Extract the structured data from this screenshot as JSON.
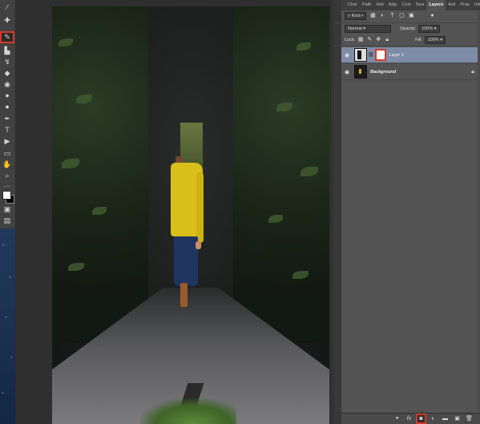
{
  "toolbar": {
    "tools": [
      {
        "id": "eyedropper",
        "glyph": "⁄"
      },
      {
        "id": "healing",
        "glyph": "✚"
      },
      {
        "id": "brush",
        "glyph": "✎"
      },
      {
        "id": "stamp",
        "glyph": "▙"
      },
      {
        "id": "history",
        "glyph": "↯"
      },
      {
        "id": "eraser",
        "glyph": "◆"
      },
      {
        "id": "gradient",
        "glyph": "◉"
      },
      {
        "id": "blur",
        "glyph": "●"
      },
      {
        "id": "dodge",
        "glyph": "●"
      },
      {
        "id": "pen",
        "glyph": "✒"
      },
      {
        "id": "text",
        "glyph": "T"
      },
      {
        "id": "path-select",
        "glyph": "▶"
      },
      {
        "id": "shape",
        "glyph": "▭"
      },
      {
        "id": "hand",
        "glyph": "✋"
      },
      {
        "id": "zoom",
        "glyph": "⌕"
      },
      {
        "id": "more",
        "glyph": "…"
      }
    ],
    "active_tool": "brush"
  },
  "panel": {
    "tabs": [
      "Char",
      "Path",
      "Hist",
      "Adjs",
      "Colo",
      "Swa",
      "Layers",
      "Acti",
      "Prop",
      "Info"
    ],
    "active_tab": "Layers",
    "filter": {
      "kind_label": "Kind"
    },
    "blend_mode": "Normal",
    "opacity_label": "Opacity:",
    "opacity_value": "100%",
    "lock_label": "Lock:",
    "fill_label": "Fill:",
    "fill_value": "100%",
    "layers": [
      {
        "name": "Layer 1",
        "selected": true,
        "has_mask": true
      },
      {
        "name": "Background",
        "selected": false,
        "locked": true
      }
    ]
  },
  "colors": {
    "accent": "#d43a2a",
    "selection": "#7f8ca8"
  }
}
